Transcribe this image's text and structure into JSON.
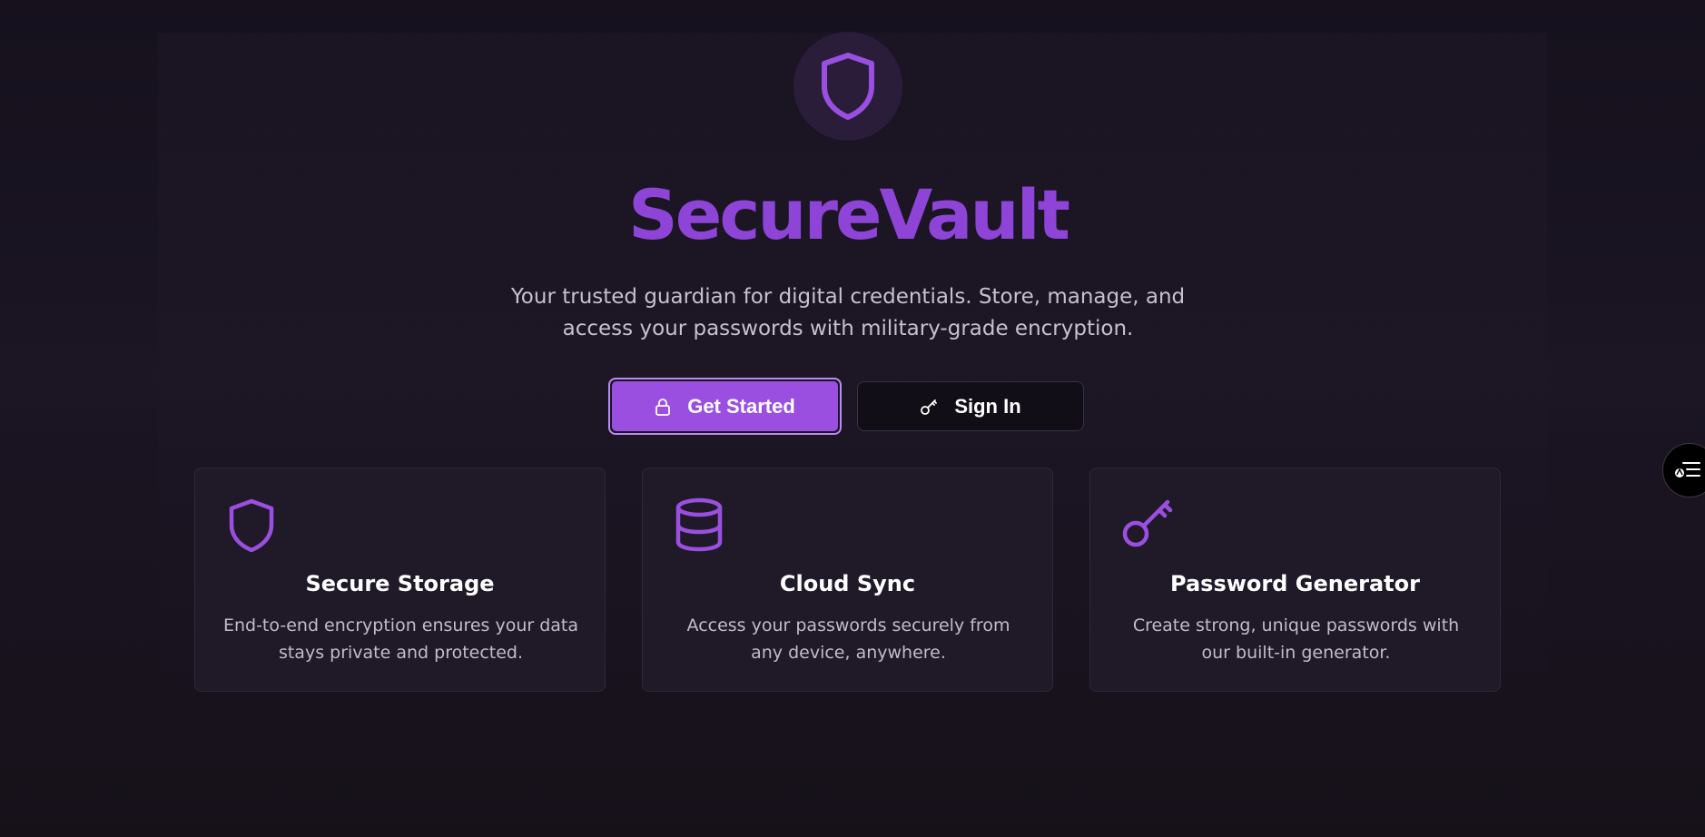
{
  "app": {
    "title": "SecureVault",
    "tagline": "Your trusted guardian for digital credentials. Store, manage, and access your passwords with military-grade encryption."
  },
  "actions": {
    "get_started_label": "Get Started",
    "sign_in_label": "Sign In"
  },
  "features": [
    {
      "icon": "shield-icon",
      "title": "Secure Storage",
      "description": "End-to-end encryption ensures your data stays private and protected."
    },
    {
      "icon": "database-icon",
      "title": "Cloud Sync",
      "description": "Access your passwords securely from any device, anywhere."
    },
    {
      "icon": "key-icon",
      "title": "Password Generator",
      "description": "Create strong, unique passwords with our built-in generator."
    }
  ],
  "colors": {
    "accent": "#9b4fe0",
    "title": "#8e44d6",
    "background": "#16111d",
    "card": "#1f1928"
  }
}
